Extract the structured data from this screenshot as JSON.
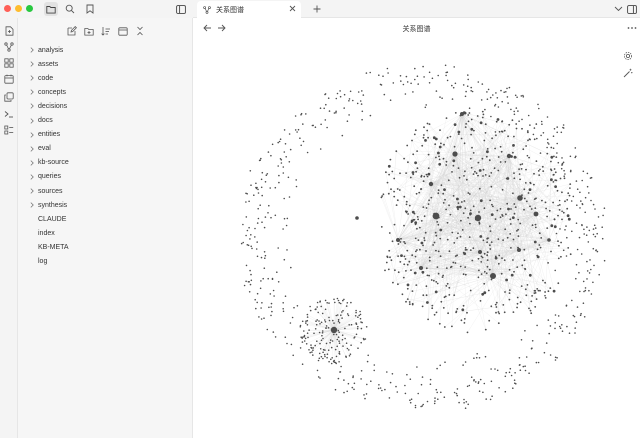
{
  "window": {
    "traffic_colors": [
      "#ff5f57",
      "#febc2e",
      "#28c840"
    ]
  },
  "sidebar_header": {
    "icons": [
      "folder-icon",
      "search-icon",
      "bookmark-icon",
      "sidebar-toggle-icon"
    ]
  },
  "ribbon": {
    "icons": [
      "open-file-icon",
      "graph-view-icon",
      "canvas-icon",
      "calendar-icon",
      "copy-icon",
      "terminal-icon",
      "bases-icon"
    ]
  },
  "file_explorer": {
    "action_icons": [
      "new-note-icon",
      "new-folder-icon",
      "sort-icon",
      "collapse-all-icon",
      "close-icon"
    ],
    "folders": [
      "analysis",
      "assets",
      "code",
      "concepts",
      "decisions",
      "docs",
      "entities",
      "eval",
      "kb-source",
      "queries",
      "sources",
      "synthesis"
    ],
    "files": [
      "CLAUDE",
      "index",
      "KB-META",
      "log"
    ]
  },
  "tab": {
    "title": "关系图谱",
    "icon": "graph-icon"
  },
  "view": {
    "title": "关系图谱",
    "tool_icons": [
      "settings-icon",
      "magic-wand-icon"
    ]
  },
  "colors": {
    "node": "#4d4d4d",
    "edge": "#cfcfcf",
    "sidebar_bg": "#f6f6f6"
  }
}
